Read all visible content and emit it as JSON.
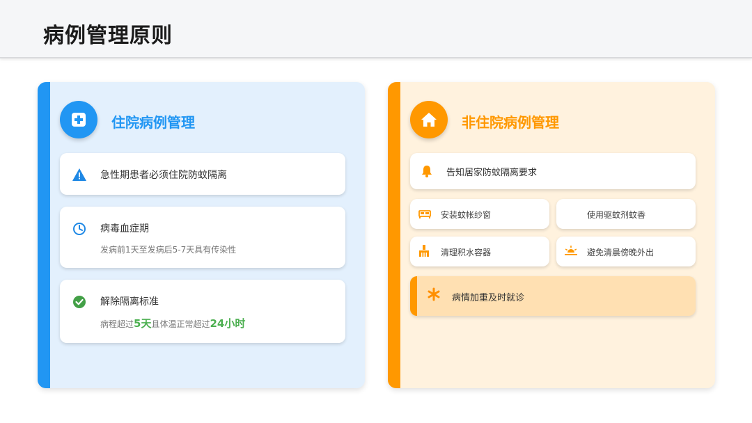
{
  "page": {
    "title": "病例管理原则"
  },
  "inpatient": {
    "title": "住院病例管理",
    "cards": [
      {
        "text": "急性期患者必须住院防蚊隔离"
      },
      {
        "text": "病毒血症期",
        "sub": "发病前1天至发病后5-7天具有传染性"
      },
      {
        "text": "解除隔离标准",
        "sub_pre": "病程超过",
        "sub_hl1": "5天",
        "sub_mid": "且体温正常超过",
        "sub_hl2": "24小时"
      }
    ]
  },
  "outpatient": {
    "title": "非住院病例管理",
    "top_card": "告知居家防蚊隔离要求",
    "grid": [
      "安装蚊帐纱窗",
      "使用驱蚊剂蚊香",
      "清理积水容器",
      "避免清晨傍晚外出"
    ],
    "alert": "病情加重及时就诊"
  },
  "colors": {
    "blue": "#2196f3",
    "orange": "#ff9800",
    "green": "#4caf50"
  }
}
